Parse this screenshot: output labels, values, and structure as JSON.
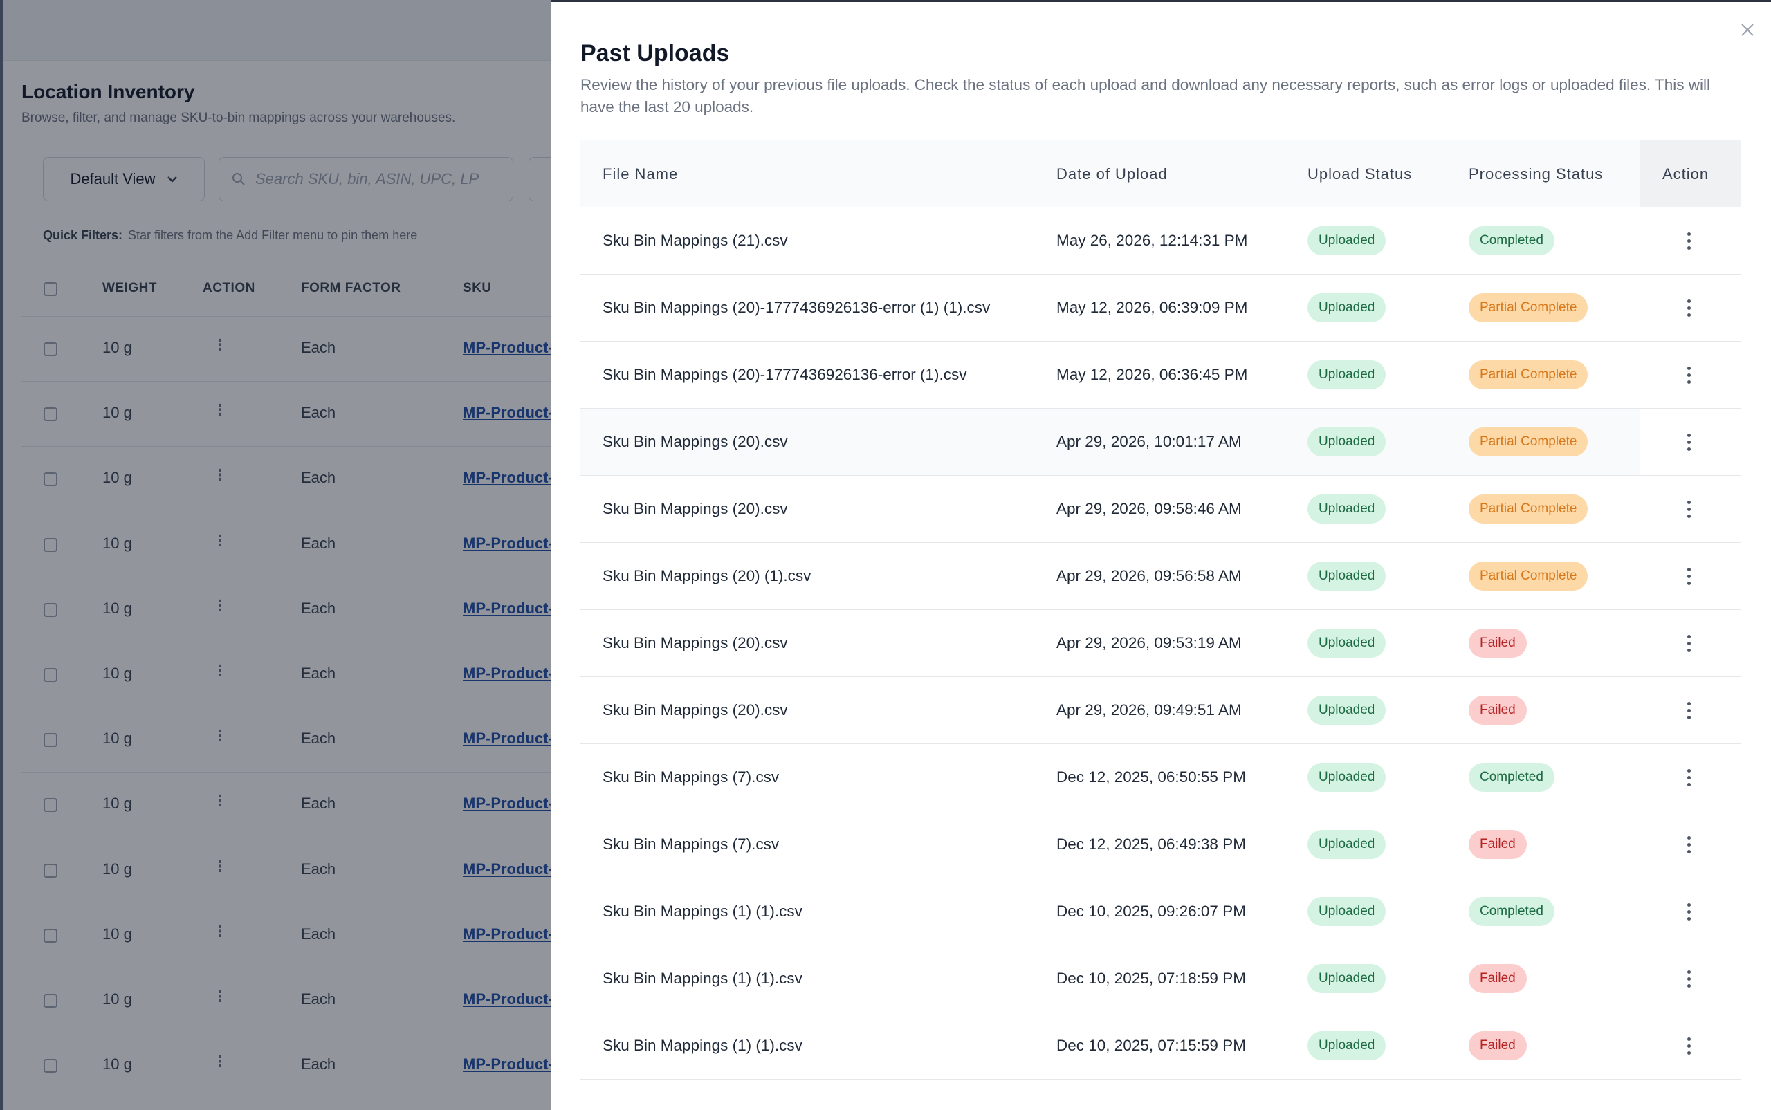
{
  "background": {
    "title": "Location Inventory",
    "subtitle": "Browse, filter, and manage SKU-to-bin mappings across your warehouses.",
    "view_select": "Default View",
    "search_placeholder": "Search SKU, bin, ASIN, UPC, LP",
    "quick_filters_label": "Quick Filters:",
    "quick_filters_hint": "Star filters from the Add Filter menu to pin them here",
    "columns": [
      "WEIGHT",
      "ACTION",
      "FORM FACTOR",
      "SKU"
    ],
    "row_weight": "10 g",
    "row_form_factor": "Each",
    "row_sku": "MP-Product-"
  },
  "modal": {
    "title": "Past Uploads",
    "description": "Review the history of your previous file uploads. Check the status of each upload and download any necessary reports, such as error logs or uploaded files. This will have the last 20 uploads.",
    "columns": {
      "file_name": "File Name",
      "date": "Date of Upload",
      "upload_status": "Upload Status",
      "processing_status": "Processing Status",
      "action": "Action"
    },
    "rows": [
      {
        "file": "Sku Bin Mappings (21).csv",
        "date": "May 26, 2026, 12:14:31 PM",
        "upload": "Uploaded",
        "processing": "Completed"
      },
      {
        "file": "Sku Bin Mappings (20)-1777436926136-error (1) (1).csv",
        "date": "May 12, 2026, 06:39:09 PM",
        "upload": "Uploaded",
        "processing": "Partial Complete"
      },
      {
        "file": "Sku Bin Mappings (20)-1777436926136-error (1).csv",
        "date": "May 12, 2026, 06:36:45 PM",
        "upload": "Uploaded",
        "processing": "Partial Complete"
      },
      {
        "file": "Sku Bin Mappings (20).csv",
        "date": "Apr 29, 2026, 10:01:17 AM",
        "upload": "Uploaded",
        "processing": "Partial Complete"
      },
      {
        "file": "Sku Bin Mappings (20).csv",
        "date": "Apr 29, 2026, 09:58:46 AM",
        "upload": "Uploaded",
        "processing": "Partial Complete"
      },
      {
        "file": "Sku Bin Mappings (20) (1).csv",
        "date": "Apr 29, 2026, 09:56:58 AM",
        "upload": "Uploaded",
        "processing": "Partial Complete"
      },
      {
        "file": "Sku Bin Mappings (20).csv",
        "date": "Apr 29, 2026, 09:53:19 AM",
        "upload": "Uploaded",
        "processing": "Failed"
      },
      {
        "file": "Sku Bin Mappings (20).csv",
        "date": "Apr 29, 2026, 09:49:51 AM",
        "upload": "Uploaded",
        "processing": "Failed"
      },
      {
        "file": "Sku Bin Mappings (7).csv",
        "date": "Dec 12, 2025, 06:50:55 PM",
        "upload": "Uploaded",
        "processing": "Completed"
      },
      {
        "file": "Sku Bin Mappings (7).csv",
        "date": "Dec 12, 2025, 06:49:38 PM",
        "upload": "Uploaded",
        "processing": "Failed"
      },
      {
        "file": "Sku Bin Mappings (1) (1).csv",
        "date": "Dec 10, 2025, 09:26:07 PM",
        "upload": "Uploaded",
        "processing": "Completed"
      },
      {
        "file": "Sku Bin Mappings (1) (1).csv",
        "date": "Dec 10, 2025, 07:18:59 PM",
        "upload": "Uploaded",
        "processing": "Failed"
      },
      {
        "file": "Sku Bin Mappings (1) (1).csv",
        "date": "Dec 10, 2025, 07:15:59 PM",
        "upload": "Uploaded",
        "processing": "Failed"
      }
    ]
  },
  "status_colors": {
    "Uploaded": "#d4f3e2",
    "Completed": "#d4f3e2",
    "Partial Complete": "#fdd9a8",
    "Failed": "#fbcdcd"
  }
}
